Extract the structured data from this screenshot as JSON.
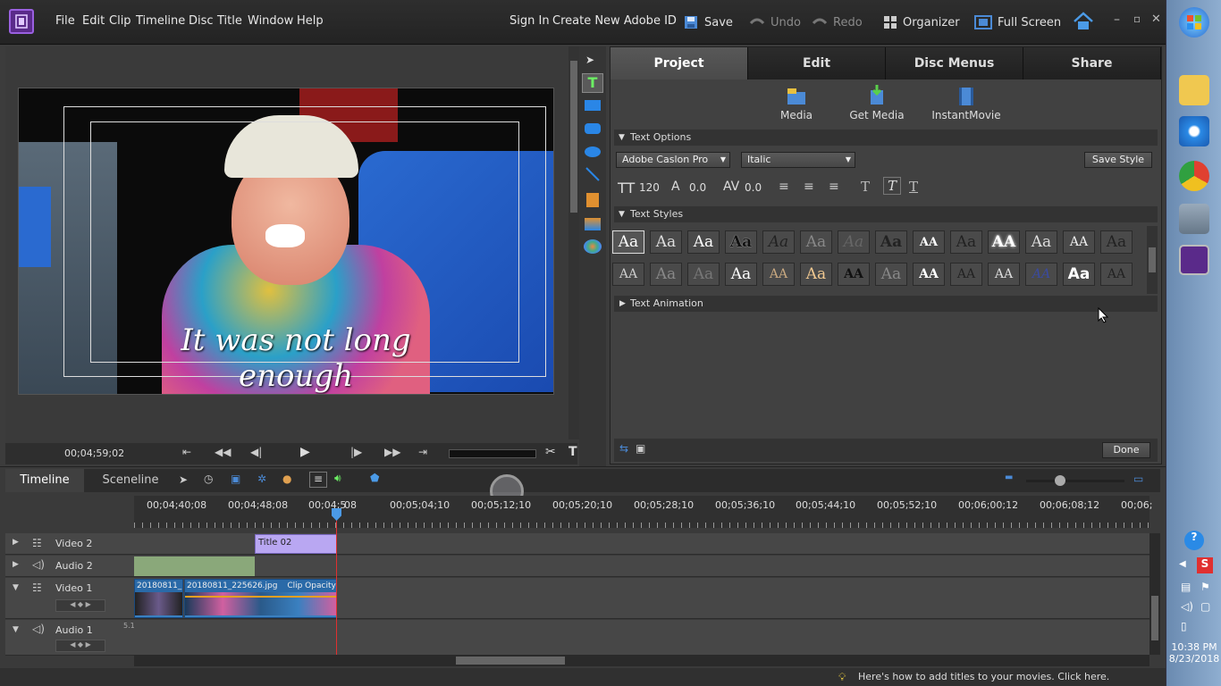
{
  "menu": [
    "File",
    "Edit",
    "Clip",
    "Timeline",
    "Disc",
    "Title",
    "Window",
    "Help"
  ],
  "account": {
    "sign_in": "Sign In",
    "create_id": "Create New Adobe ID"
  },
  "toolbar": {
    "save": "Save",
    "undo": "Undo",
    "redo": "Redo",
    "organizer": "Organizer",
    "fullscreen": "Full Screen"
  },
  "monitor": {
    "caption": "It was not long enough",
    "timecode": "00;04;59;02"
  },
  "tabs": [
    "Project",
    "Edit",
    "Disc Menus",
    "Share"
  ],
  "media_buttons": [
    "Media",
    "Get Media",
    "InstantMovie"
  ],
  "text_options": {
    "header": "Text Options",
    "font": "Adobe Caslon Pro",
    "style": "Italic",
    "save_style": "Save Style",
    "size": "120",
    "leading": "0.0",
    "kerning": "0.0"
  },
  "text_styles": {
    "header": "Text Styles",
    "row1": [
      "Aa",
      "Aa",
      "Aa",
      "Aa",
      "Aa",
      "Aa",
      "Aa",
      "Aa",
      "AA",
      "Aa",
      "AA",
      "Aa",
      "AA",
      "Aa"
    ],
    "row2": [
      "AA",
      "Aa",
      "Aa",
      "Aa",
      "AA",
      "Aa",
      "AA",
      "Aa",
      "AA",
      "AA",
      "AA",
      "AA",
      "Aa",
      "AA"
    ]
  },
  "text_animation": {
    "header": "Text Animation"
  },
  "done": "Done",
  "timeline_tabs": [
    "Timeline",
    "Sceneline"
  ],
  "ruler": [
    "00;04;40;08",
    "00;04;48;08",
    "00;04;5",
    "08",
    "00;05;04;10",
    "00;05;12;10",
    "00;05;20;10",
    "00;05;28;10",
    "00;05;36;10",
    "00;05;44;10",
    "00;05;52;10",
    "00;06;00;12",
    "00;06;08;12",
    "00;06;"
  ],
  "tracks": {
    "video2": "Video 2",
    "audio2": "Audio 2",
    "video1": "Video 1",
    "audio1": "Audio 1",
    "title_clip": "Title 02",
    "clip1": "20180811_",
    "clip2": "20180811_225626.jpg",
    "clip_opacity": "Clip Opacity",
    "audio1_badge": "5.1"
  },
  "status_hint": "Here's how to add titles to your movies. Click here.",
  "clock": {
    "time": "10:38 PM",
    "date": "8/23/2018"
  },
  "colors": {
    "accent": "#8a4fd0",
    "title_clip": "#b9a7f2",
    "audio_clip": "#8aa87a",
    "playhead": "#e03030"
  }
}
